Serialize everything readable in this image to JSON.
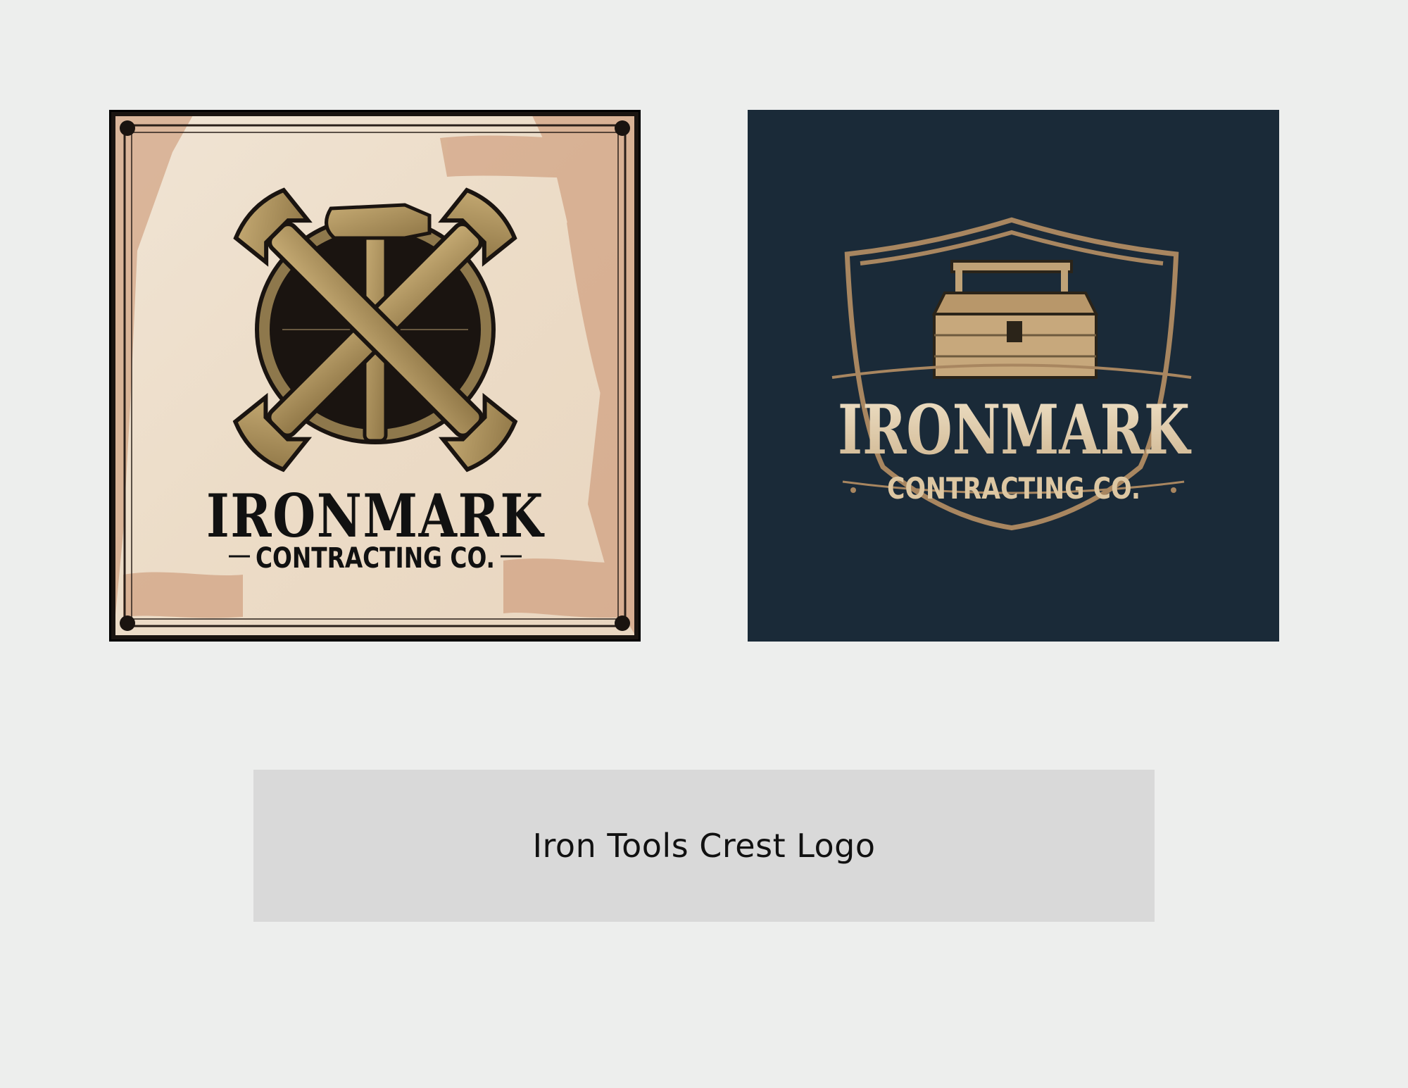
{
  "logos": [
    {
      "name_line": "IRONMARK",
      "sub_line": "CONTRACTING CO.",
      "icon": "crossed-wrenches-hammer-icon",
      "colors": {
        "background": "#eadccb",
        "ink": "#111111",
        "metal": "#a88f5a",
        "frame": "#1a1410"
      }
    },
    {
      "name_line": "IRONMARK",
      "sub_line": "CONTRACTING CO.",
      "icon": "toolbox-shield-icon",
      "colors": {
        "background": "#1a2a38",
        "ink": "#e4d2b6",
        "metal": "#a88660"
      }
    }
  ],
  "caption": "Iron Tools Crest Logo"
}
